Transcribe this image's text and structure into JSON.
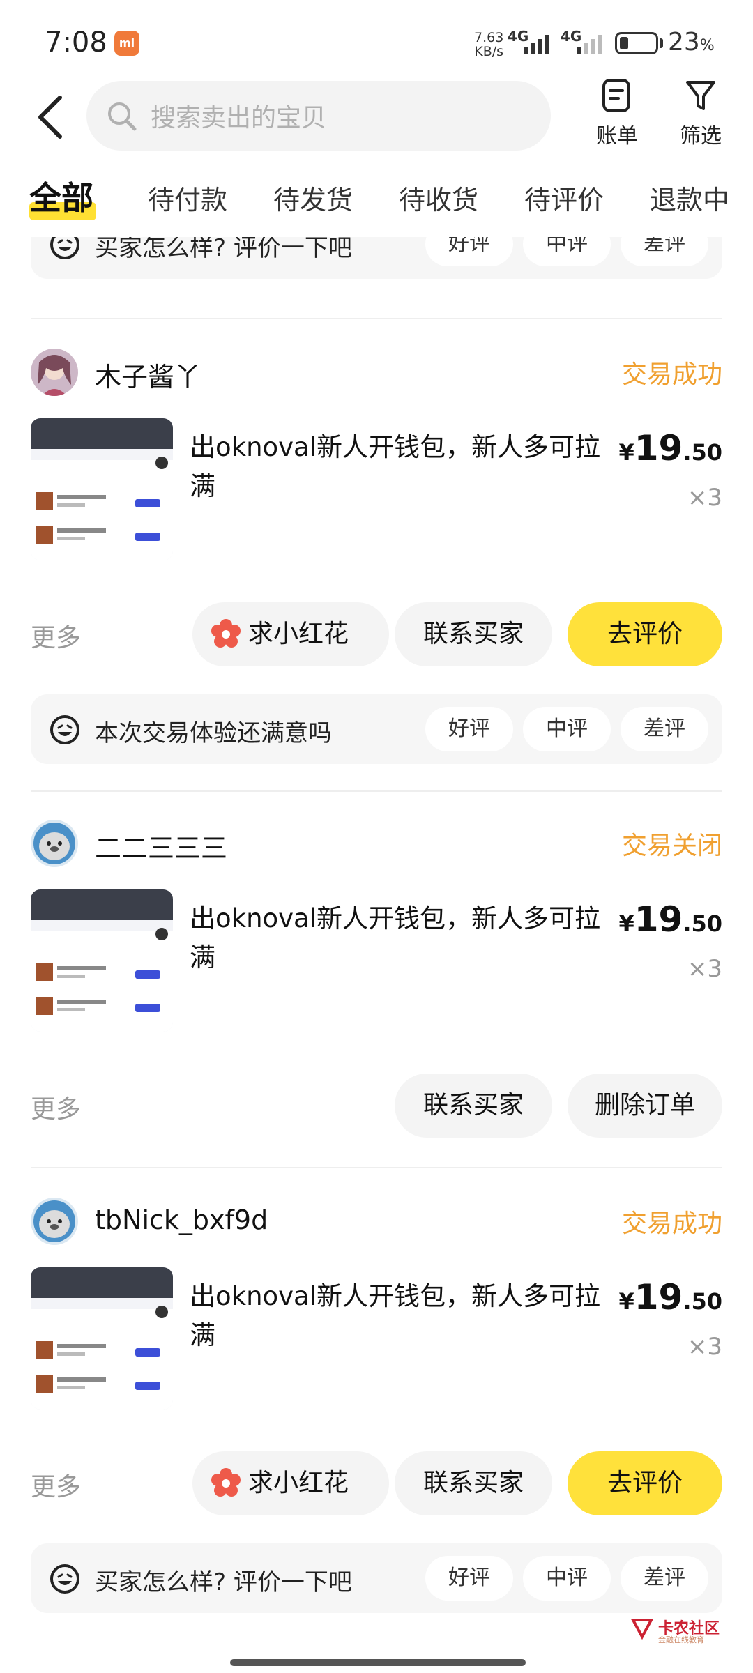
{
  "status_bar": {
    "time": "7:08",
    "mi_badge": "mi",
    "speed_value": "7.63",
    "speed_unit": "KB/s",
    "network_1": "4G",
    "network_2": "4G",
    "battery_value": "23",
    "battery_unit": "%"
  },
  "header": {
    "search_placeholder": "搜索卖出的宝贝",
    "bill_label": "账单",
    "filter_label": "筛选"
  },
  "tabs": [
    "全部",
    "待付款",
    "待发货",
    "待收货",
    "待评价",
    "退款中"
  ],
  "top_review_bar": {
    "prompt": "买家怎么样? 评价一下吧",
    "good": "好评",
    "mid": "中评",
    "bad": "差评"
  },
  "orders": [
    {
      "buyer": "木子酱丫",
      "status": "交易成功",
      "title": "出oknoval新人开钱包，新人多可拉满",
      "currency": "¥",
      "price_int": "19",
      "price_dec": ".50",
      "qty": "×3",
      "more": "更多",
      "flower_button": "求小红花",
      "contact_button": "联系买家",
      "action_button": "去评价",
      "review_prompt": "本次交易体验还满意吗",
      "review_good": "好评",
      "review_mid": "中评",
      "review_bad": "差评"
    },
    {
      "buyer": "二二三三三",
      "status": "交易关闭",
      "title": "出oknoval新人开钱包，新人多可拉满",
      "currency": "¥",
      "price_int": "19",
      "price_dec": ".50",
      "qty": "×3",
      "more": "更多",
      "contact_button": "联系买家",
      "action_button": "删除订单"
    },
    {
      "buyer": "tbNick_bxf9d",
      "status": "交易成功",
      "title": "出oknoval新人开钱包，新人多可拉满",
      "currency": "¥",
      "price_int": "19",
      "price_dec": ".50",
      "qty": "×3",
      "more": "更多",
      "flower_button": "求小红花",
      "contact_button": "联系买家",
      "action_button": "去评价",
      "review_prompt": "买家怎么样? 评价一下吧",
      "review_good": "好评",
      "review_mid": "中评",
      "review_bad": "差评"
    }
  ],
  "watermark": {
    "title": "卡农社区",
    "subtitle": "金融在线教育"
  },
  "colors": {
    "accent_yellow": "#ffe13b",
    "status_orange": "#f0a030",
    "flower_red": "#ee5a4a"
  }
}
